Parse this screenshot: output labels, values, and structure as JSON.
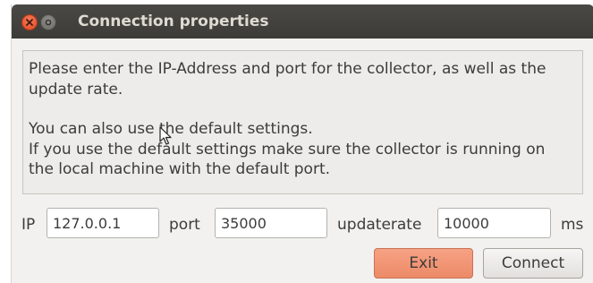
{
  "window": {
    "title": "Connection properties"
  },
  "message": {
    "line1": "Please enter the IP-Address and port for the collector, as well as the",
    "line2": "update rate.",
    "line3": "You can also use the default settings.",
    "line4": "If you use the default settings make sure the collector is running on",
    "line5": "the local machine with the default port."
  },
  "form": {
    "ip_label": "IP",
    "ip_value": "127.0.0.1",
    "port_label": "port",
    "port_value": "35000",
    "updaterate_label": "updaterate",
    "updaterate_value": "10000",
    "unit_label": "ms"
  },
  "buttons": {
    "exit_label": "Exit",
    "connect_label": "Connect"
  },
  "icons": {
    "close": "close-icon",
    "minimize": "minimize-icon",
    "cursor": "mouse-pointer-icon"
  },
  "colors": {
    "titlebar": "#3c3b37",
    "close_button": "#e0491f",
    "exit_button": "#ec8a67",
    "window_bg": "#f2f1f0"
  }
}
